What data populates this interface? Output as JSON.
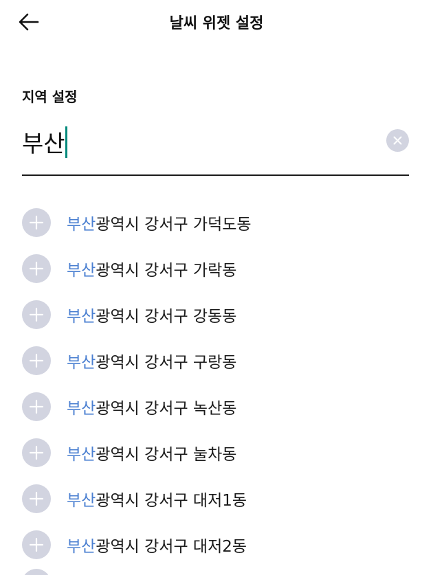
{
  "header": {
    "title": "날씨 위젯 설정",
    "back_icon": "arrow-left-icon"
  },
  "region": {
    "label": "지역 설정",
    "query": "부산",
    "clear_icon": "close-icon"
  },
  "results": {
    "highlight": "부산",
    "items": [
      {
        "rest": "광역시 강서구 가덕도동"
      },
      {
        "rest": "광역시 강서구 가락동"
      },
      {
        "rest": "광역시 강서구 강동동"
      },
      {
        "rest": "광역시 강서구 구랑동"
      },
      {
        "rest": "광역시 강서구 녹산동"
      },
      {
        "rest": "광역시 강서구 눌차동"
      },
      {
        "rest": "광역시 강서구 대저1동"
      },
      {
        "rest": "광역시 강서구 대저2동"
      }
    ]
  },
  "colors": {
    "highlight": "#4a7fd1",
    "caret": "#00897b",
    "icon_bg": "#d2d4e0"
  }
}
